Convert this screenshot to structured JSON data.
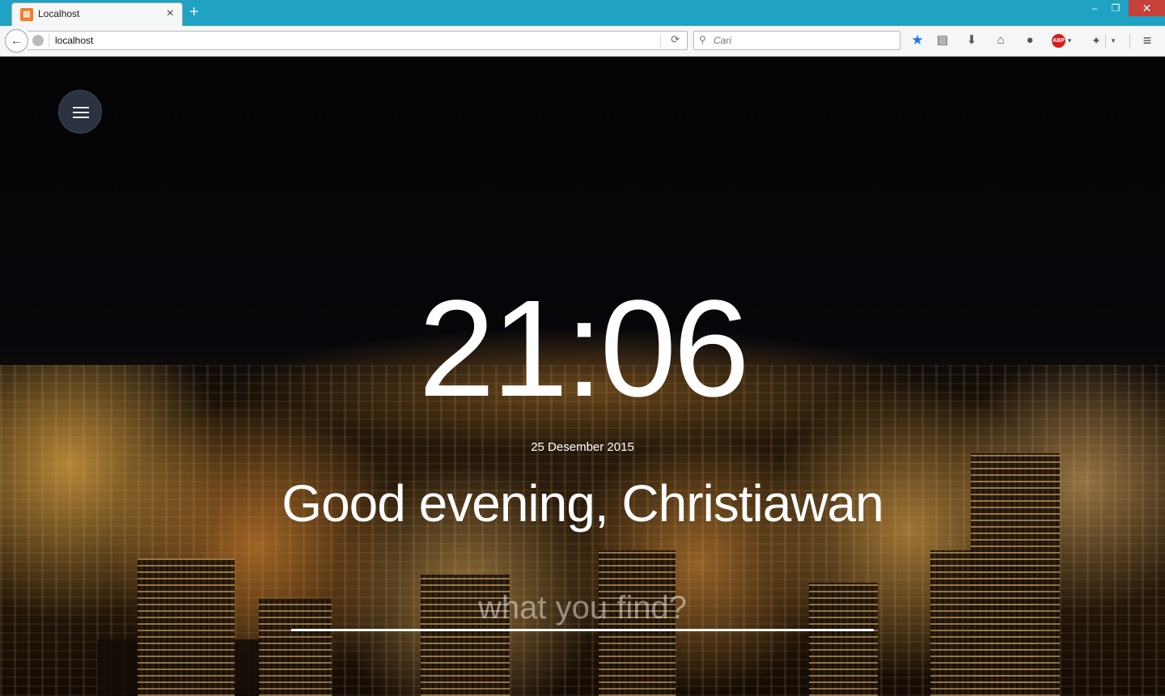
{
  "browser": {
    "tab": {
      "title": "Localhost",
      "favicon": "xampp-icon",
      "close": "×"
    },
    "new_tab": "+",
    "window_controls": {
      "minimize": "–",
      "restore": "❐",
      "close": "✕"
    },
    "url": "localhost",
    "search_placeholder": "Cari",
    "toolbar_icons": [
      "star-icon",
      "reading-list-icon",
      "download-icon",
      "home-icon",
      "chat-icon",
      "adblock-icon",
      "extension-icon",
      "menu-icon"
    ],
    "adblock_label": "ABP",
    "colors": {
      "titlebar": "#1fa2c3",
      "bookmark_star": "#1f78e0",
      "adblock": "#d81c1c"
    }
  },
  "page": {
    "clock": "21:06",
    "date": "25 Desember 2015",
    "greeting": "Good evening, Christiawan",
    "search_placeholder": "what you find?",
    "menu_button": "hamburger-menu-icon"
  }
}
